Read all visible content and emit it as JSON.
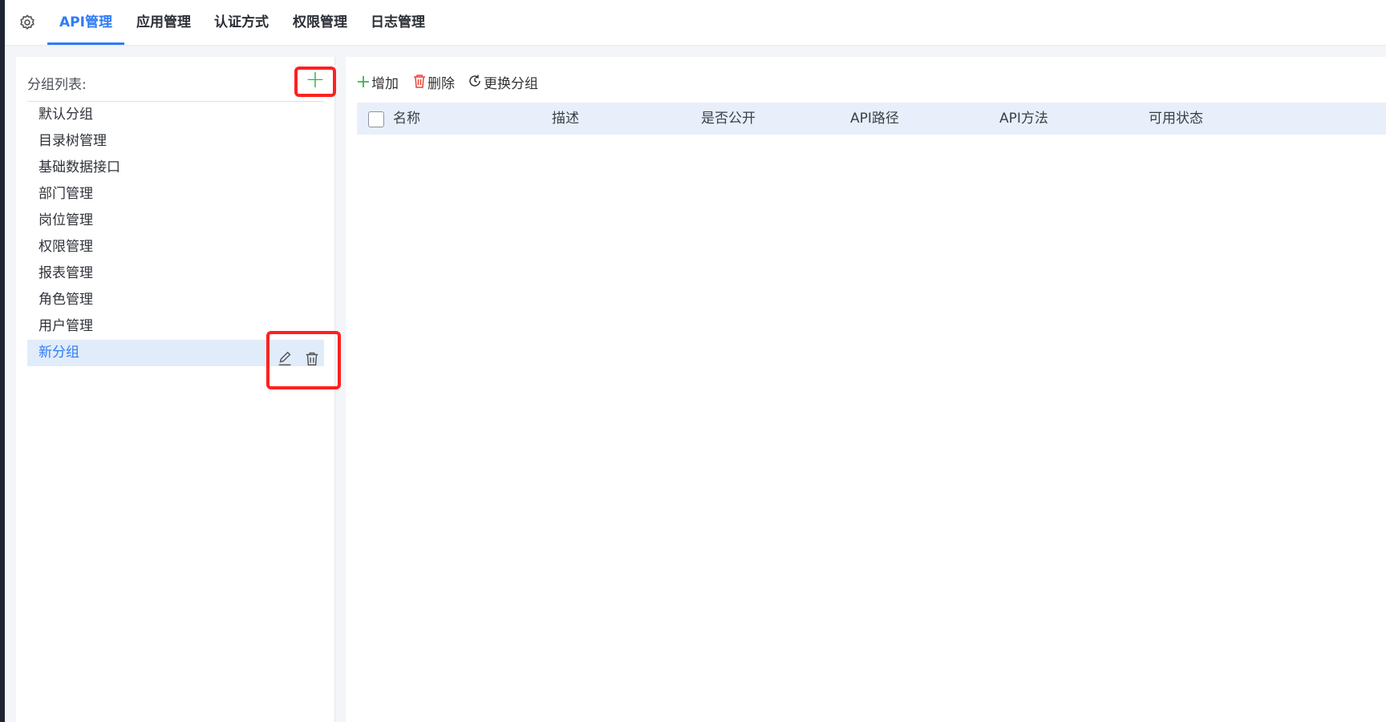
{
  "nav": {
    "settings_icon": "gear-icon",
    "tabs": [
      "API管理",
      "应用管理",
      "认证方式",
      "权限管理",
      "日志管理"
    ],
    "active_tab": "API管理",
    "accent": "#2f7cf6"
  },
  "sidebar": {
    "title": "分组列表:",
    "add_icon": "plus-icon",
    "groups": [
      "默认分组",
      "目录树管理",
      "基础数据接口",
      "部门管理",
      "岗位管理",
      "权限管理",
      "报表管理",
      "角色管理",
      "用户管理",
      "新分组"
    ],
    "selected_group": "新分组",
    "item_action_icons": [
      "edit-icon",
      "trash-icon"
    ]
  },
  "toolbar": {
    "add_label": "增加",
    "delete_label": "删除",
    "change_group_label": "更换分组"
  },
  "table": {
    "columns": [
      "名称",
      "描述",
      "是否公开",
      "API路径",
      "API方法",
      "可用状态"
    ],
    "rows": []
  },
  "colors": {
    "highlight_box": "#ff2020",
    "add_green": "#3bb44a",
    "delete_red": "#e8433a",
    "header_bg": "#e8effa",
    "selected_bg": "#e1ecfb"
  }
}
